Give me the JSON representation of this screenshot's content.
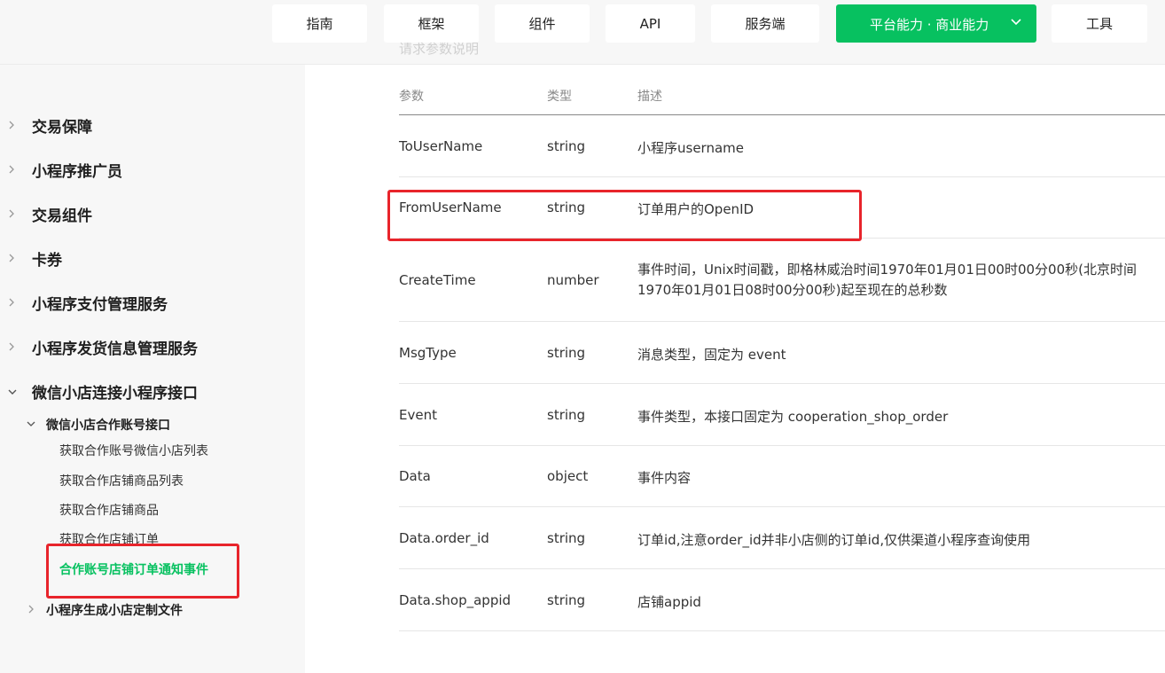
{
  "topnav": {
    "items": [
      "指南",
      "框架",
      "组件",
      "API",
      "服务端",
      "平台能力 · 商业能力",
      "工具"
    ],
    "active_index": 5,
    "accent": "#07c160"
  },
  "behind_text": "请求参数说明",
  "sidebar": {
    "items": [
      "交易保障",
      "小程序推广员",
      "交易组件",
      "卡券",
      "小程序支付管理服务",
      "小程序发货信息管理服务",
      "微信小店连接小程序接口"
    ],
    "sub": {
      "label": "微信小店合作账号接口",
      "leaves": [
        "获取合作账号微信小店列表",
        "获取合作店铺商品列表",
        "获取合作店铺商品",
        "获取合作店铺订单",
        "合作账号店铺订单通知事件"
      ],
      "active_index": 4
    },
    "sub2": "小程序生成小店定制文件"
  },
  "table": {
    "headers": [
      "参数",
      "类型",
      "描述"
    ],
    "rows": [
      {
        "param": "ToUserName",
        "type": "string",
        "desc": "小程序username"
      },
      {
        "param": "FromUserName",
        "type": "string",
        "desc": "订单用户的OpenID"
      },
      {
        "param": "CreateTime",
        "type": "number",
        "desc": "事件时间，Unix时间戳，即格林威治时间1970年01月01日00时00分00秒(北京时间1970年01月01日08时00分00秒)起至现在的总秒数"
      },
      {
        "param": "MsgType",
        "type": "string",
        "desc": "消息类型，固定为 event"
      },
      {
        "param": "Event",
        "type": "string",
        "desc": "事件类型，本接口固定为 cooperation_shop_order"
      },
      {
        "param": "Data",
        "type": "object",
        "desc": "事件内容"
      },
      {
        "param": "Data.order_id",
        "type": "string",
        "desc": "订单id,注意order_id并非小店侧的订单id,仅供渠道小程序查询使用"
      },
      {
        "param": "Data.shop_appid",
        "type": "string",
        "desc": "店铺appid"
      }
    ]
  },
  "highlight_color": "#e8242b"
}
